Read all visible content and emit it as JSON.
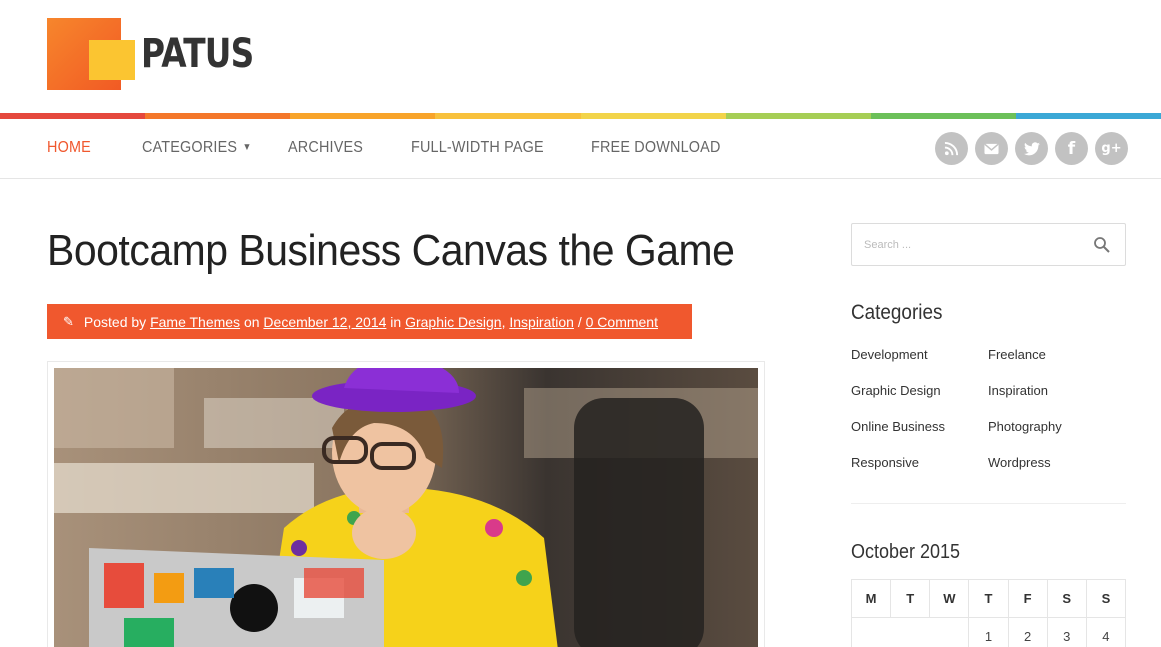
{
  "brand": {
    "name": "PATUS"
  },
  "rainbow": [
    "#e5483d",
    "#f4772a",
    "#f8a42a",
    "#f8c13c",
    "#f2d44a",
    "#a6ce55",
    "#6cc059",
    "#3ba8d6"
  ],
  "nav": {
    "items": [
      {
        "label": "HOME",
        "active": true
      },
      {
        "label": "CATEGORIES",
        "dropdown": true
      },
      {
        "label": "ARCHIVES"
      },
      {
        "label": "FULL-WIDTH PAGE"
      },
      {
        "label": "FREE DOWNLOAD"
      }
    ],
    "social": [
      "rss-icon",
      "email-icon",
      "twitter-icon",
      "facebook-icon",
      "google-plus-icon"
    ]
  },
  "post": {
    "title": "Bootcamp Business Canvas the Game",
    "meta": {
      "posted_by": "Posted by",
      "author": "Fame Themes",
      "on": "on",
      "date": "December 12, 2014",
      "in": "in",
      "cat1": "Graphic Design",
      "comma": ",",
      "cat2": "Inspiration",
      "slash": "/",
      "comments": "0 Comment"
    }
  },
  "sidebar": {
    "search": {
      "placeholder": "Search ..."
    },
    "categories": {
      "title": "Categories",
      "items": [
        "Development",
        "Freelance",
        "Graphic Design",
        "Inspiration",
        "Online Business",
        "Photography",
        "Responsive",
        "Wordpress"
      ]
    },
    "calendar": {
      "title": "October 2015",
      "days": [
        "M",
        "T",
        "W",
        "T",
        "F",
        "S",
        "S"
      ],
      "first_row": [
        "",
        "",
        "",
        "1",
        "2",
        "3",
        "4"
      ]
    }
  },
  "colors": {
    "accent": "#f0582e",
    "social": "#c2c2c2"
  }
}
